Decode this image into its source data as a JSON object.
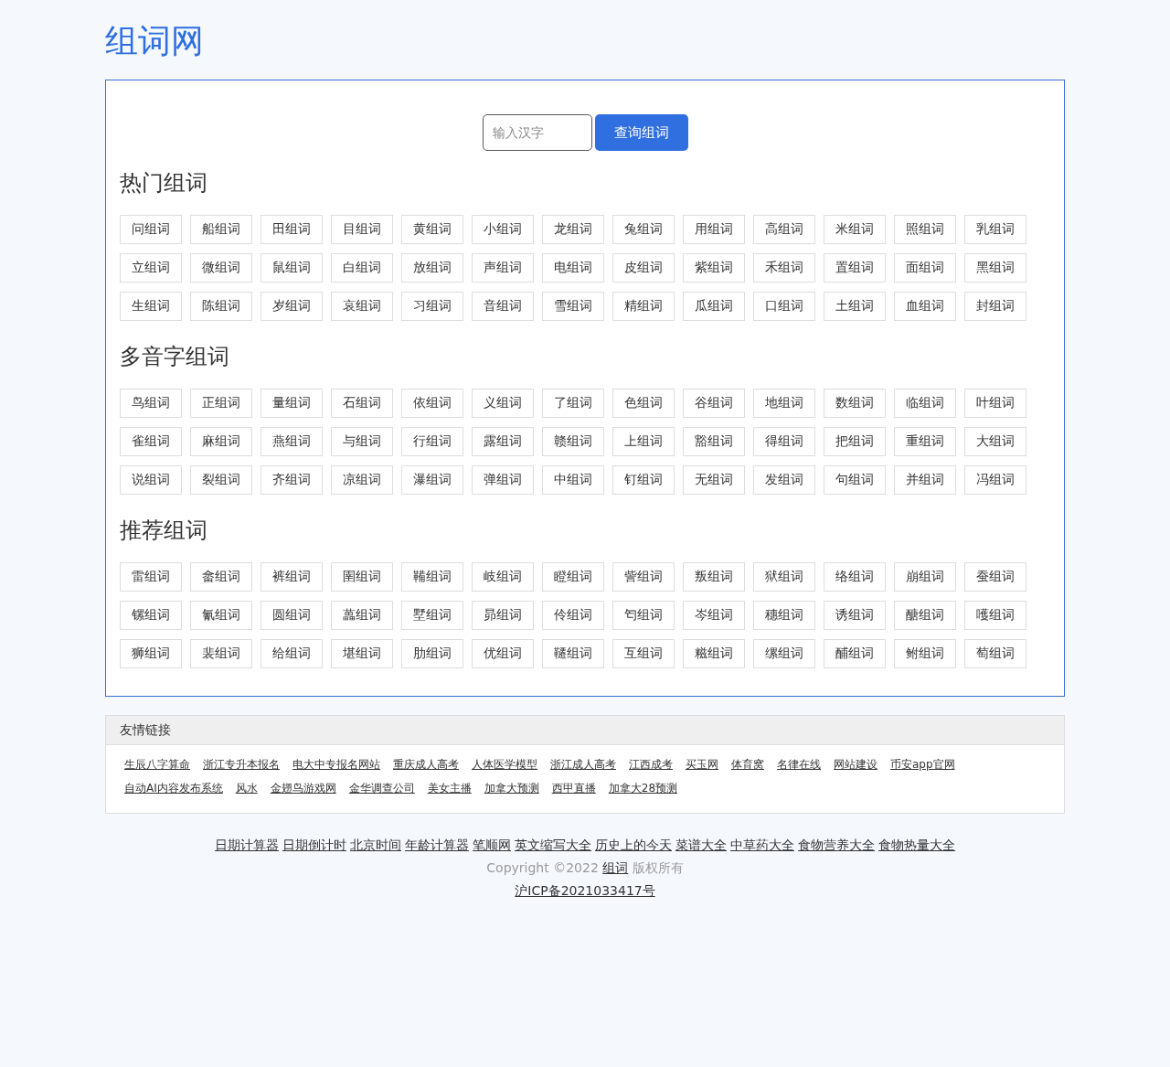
{
  "logo": "组词网",
  "search": {
    "placeholder": "输入汉字",
    "button": "查询组词"
  },
  "sections": [
    {
      "title": "热门组词",
      "items": [
        "问组词",
        "船组词",
        "田组词",
        "目组词",
        "黄组词",
        "小组词",
        "龙组词",
        "兔组词",
        "用组词",
        "高组词",
        "米组词",
        "照组词",
        "乳组词",
        "立组词",
        "微组词",
        "鼠组词",
        "白组词",
        "放组词",
        "声组词",
        "电组词",
        "皮组词",
        "紫组词",
        "禾组词",
        "置组词",
        "面组词",
        "黑组词",
        "生组词",
        "陈组词",
        "岁组词",
        "哀组词",
        "习组词",
        "音组词",
        "雪组词",
        "精组词",
        "瓜组词",
        "口组词",
        "土组词",
        "血组词",
        "封组词"
      ]
    },
    {
      "title": "多音字组词",
      "items": [
        "鸟组词",
        "正组词",
        "量组词",
        "石组词",
        "依组词",
        "义组词",
        "了组词",
        "色组词",
        "谷组词",
        "地组词",
        "数组词",
        "临组词",
        "叶组词",
        "雀组词",
        "麻组词",
        "燕组词",
        "与组词",
        "行组词",
        "露组词",
        "赣组词",
        "上组词",
        "豁组词",
        "得组词",
        "把组词",
        "重组词",
        "大组词",
        "说组词",
        "裂组词",
        "齐组词",
        "凉组词",
        "瀑组词",
        "弹组词",
        "中组词",
        "钉组词",
        "无组词",
        "发组词",
        "句组词",
        "并组词",
        "冯组词"
      ]
    },
    {
      "title": "推荐组词",
      "items": [
        "雷组词",
        "畲组词",
        "裤组词",
        "圉组词",
        "鞴组词",
        "岐组词",
        "瞪组词",
        "訾组词",
        "叛组词",
        "狱组词",
        "络组词",
        "崩组词",
        "蚕组词",
        "镙组词",
        "氰组词",
        "圆组词",
        "藟组词",
        "墅组词",
        "昴组词",
        "伶组词",
        "匄组词",
        "岑组词",
        "穗组词",
        "诱组词",
        "醣组词",
        "嚄组词",
        "狮组词",
        "裴组词",
        "给组词",
        "堪组词",
        "肋组词",
        "优组词",
        "韆组词",
        "互组词",
        "糍组词",
        "缧组词",
        "酺组词",
        "鲋组词",
        "萄组词"
      ]
    }
  ],
  "friend_links": {
    "title": "友情链接",
    "links": [
      "生辰八字算命",
      "浙江专升本报名",
      "电大中专报名网站",
      "重庆成人高考",
      "人体医学模型",
      "浙江成人高考",
      "江西成考",
      "买玉网",
      "体育窝",
      "名律在线",
      "网站建设",
      "币安app官网",
      "自动AI内容发布系统",
      "风水",
      "金翅鸟游戏网",
      "金华调查公司",
      "美女主播",
      "加拿大预测",
      "西甲直播",
      "加拿大28预测"
    ]
  },
  "footer": {
    "links": [
      "日期计算器",
      "日期倒计时",
      "北京时间",
      "年龄计算器",
      "笔顺网",
      "英文缩写大全",
      "历史上的今天",
      "菜谱大全",
      "中草药大全",
      "食物营养大全",
      "食物热量大全"
    ],
    "copyright_before": "Copyright ©2022",
    "copyright_link": "组词",
    "copyright_after": "版权所有",
    "icp": "沪ICP备2021033417号"
  }
}
